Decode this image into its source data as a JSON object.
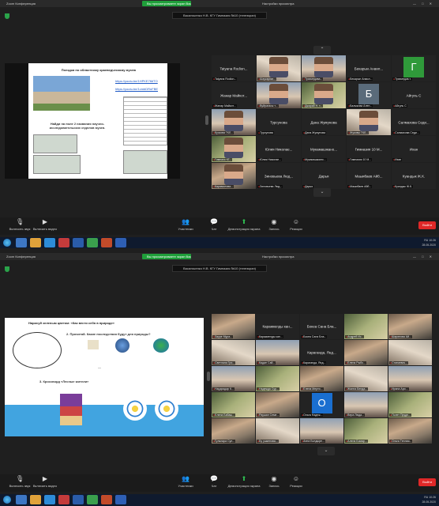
{
  "window": {
    "app_title": "Zoom Конференция",
    "banner": "Васильченко Н.В. КГУ Гимназия №10 (телеэкран)"
  },
  "sharing": {
    "status": "Вы просматриваете экран Васильченко Н.В. КГУ Гимназия",
    "options": "Настройки просмотра"
  },
  "slide1": {
    "title": "Поездки по областному краеведческому музею",
    "link1": "https://youtu.be/1HPKE7tMTO",
    "link2": "https://youtu.be/1vmbDRnFBE",
    "task": "Найди на поле 2 названия научно-исследовательских отделов музея."
  },
  "slide2": {
    "title": "Нарисуй зеленым цветом: «Как вести себя в природе»",
    "q1": "2. Прочитай. Какие последствия будут для природы?",
    "q2": "3. Кроссворд «Лесные жители»"
  },
  "gallery1": [
    {
      "name": "Tatyana Rodion...",
      "label": "Tatyana Rodion..."
    },
    {
      "name": "",
      "label": "Шаукарим..."
    },
    {
      "name": "",
      "label": "Туяхмедова..."
    },
    {
      "name": "Бекарын Анаил...",
      "label": "Бекарын Анаил..."
    },
    {
      "name": "",
      "label": "Туяхмедов.т.",
      "letter": "Г"
    },
    {
      "name": "Жанар Майкот...",
      "label": "Жанар Майкот..."
    },
    {
      "name": "",
      "label": "Вуйрагасы т..."
    },
    {
      "name": "",
      "label": "Джарай Н. т..."
    },
    {
      "name": "",
      "label": "Балыкова Ален...",
      "letter": "Б"
    },
    {
      "name": "Айгуль С",
      "label": "Айгуль С"
    },
    {
      "name": "",
      "label": "Кускова ГКЛ..."
    },
    {
      "name": "Турсунова",
      "label": "Турсунова"
    },
    {
      "name": "Дана Жумунова",
      "label": "Дана Жумунова"
    },
    {
      "name": "",
      "label": "Жуковы ГКЛ..."
    },
    {
      "name": "Салмахова Седи...",
      "label": "Салмахова Седи..."
    },
    {
      "name": "",
      "label": "Гимнахо КГ..."
    },
    {
      "name": "Юлия Николае...",
      "label": "Юлия Николае..."
    },
    {
      "name": "Мукамашжано...",
      "label": "Мукамашжано..."
    },
    {
      "name": "Гимназия 10 М...",
      "label": "Гимназия 10 М..."
    },
    {
      "name": "Ихан",
      "label": "Ихан"
    },
    {
      "name": "",
      "label": "Карамолова..."
    },
    {
      "name": "Зиновьева Люд...",
      "label": "Зиновьева Люд..."
    },
    {
      "name": "Дарья",
      "label": "Дарья"
    },
    {
      "name": "Маыибаев Айб...",
      "label": "Маыибаев Айб..."
    },
    {
      "name": "Куандык Ж.К.",
      "label": "Куандык Ж.К."
    }
  ],
  "gallery2": [
    {
      "name": "",
      "label": "Зауре Мура..."
    },
    {
      "name": "Каракмелды кан...",
      "label": "Каракмелды кан..."
    },
    {
      "name": "Бокеа Сана Бла...",
      "label": "Бокеа Сана Бла..."
    },
    {
      "name": "",
      "label": "Андрей Ис..."
    },
    {
      "name": "",
      "label": "Шарипова Ай..."
    },
    {
      "name": "",
      "label": "Светлана Гри..."
    },
    {
      "name": "",
      "label": "Кадан Сай..."
    },
    {
      "name": "Караганда, Янд...",
      "label": "Караганда, Янд..."
    },
    {
      "name": "",
      "label": "Елена Рыбо..."
    },
    {
      "name": "",
      "label": "Станкевич..."
    },
    {
      "name": "",
      "label": "Нардхадар К..."
    },
    {
      "name": "",
      "label": "Надежда Сур..."
    },
    {
      "name": "",
      "label": "Елена Мерти..."
    },
    {
      "name": "",
      "label": "Жанна Бенда..."
    },
    {
      "name": "",
      "label": "Ирина Ари..."
    },
    {
      "name": "",
      "label": "Елена Бабаш..."
    },
    {
      "name": "",
      "label": "Раушан Семе..."
    },
    {
      "name": "",
      "label": "Ольга Надеж...",
      "letter": "О"
    },
    {
      "name": "",
      "label": "Вера Люда..."
    },
    {
      "name": "",
      "label": "Полет Прудн..."
    },
    {
      "name": "",
      "label": "Гульнара Сул..."
    },
    {
      "name": "",
      "label": "Бу ушкенова..."
    },
    {
      "name": "",
      "label": "Анна Болдыре..."
    },
    {
      "name": "",
      "label": "Алена Бомар..."
    },
    {
      "name": "",
      "label": "Ольга Теплая..."
    }
  ],
  "toolbar": {
    "audio": "Включить звук",
    "video": "Включить видео",
    "participants": "Участники",
    "participants_count": "26",
    "chat": "Чат",
    "share": "Демонстрация экрана",
    "record": "Запись",
    "reactions": "Реакции",
    "end": "Выйти"
  },
  "tray": {
    "lang": "RU",
    "time": "10:26",
    "date": "28.05.2020"
  }
}
